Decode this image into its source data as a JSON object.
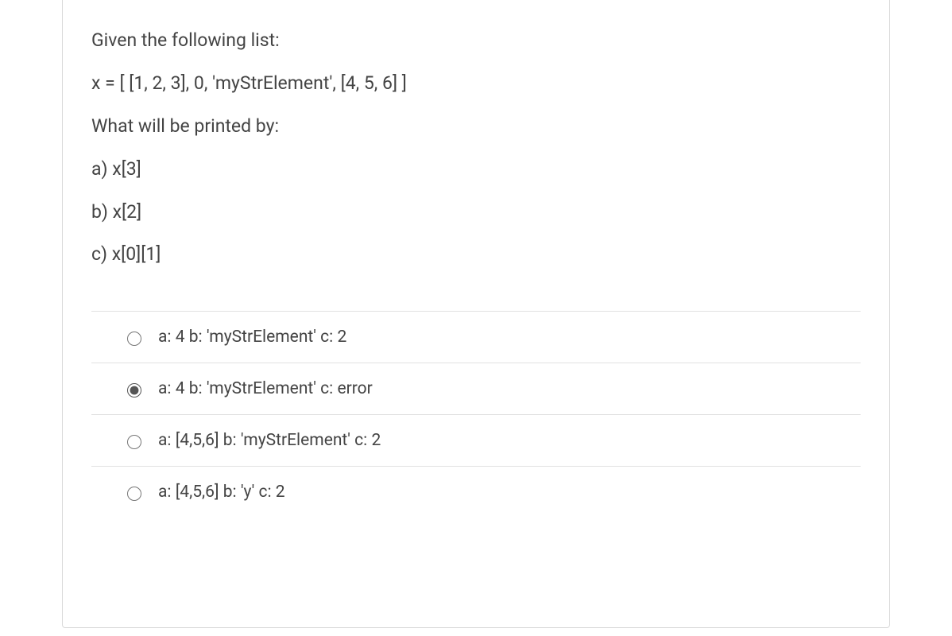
{
  "question": {
    "lines": [
      "Given the following list:",
      "x = [ [1, 2, 3], 0, 'myStrElement', [4, 5, 6] ]",
      "What will be printed by:",
      "a) x[3]",
      "b) x[2]",
      "c) x[0][1]"
    ]
  },
  "answers": [
    {
      "label": "a: 4 b: 'myStrElement' c: 2",
      "selected": false
    },
    {
      "label": "a: 4 b: 'myStrElement' c: error",
      "selected": true
    },
    {
      "label": "a: [4,5,6] b: 'myStrElement' c: 2",
      "selected": false
    },
    {
      "label": "a: [4,5,6] b: 'y' c: 2",
      "selected": false
    }
  ]
}
